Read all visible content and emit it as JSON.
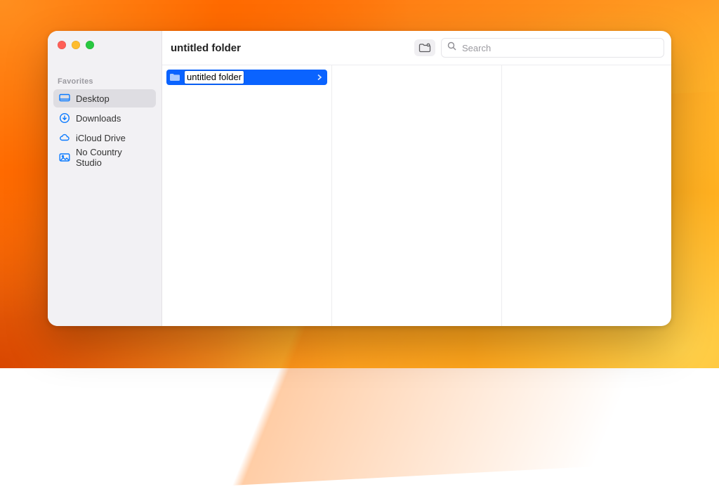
{
  "window": {
    "title": "untitled folder"
  },
  "sidebar": {
    "section_label": "Favorites",
    "items": [
      {
        "label": "Desktop",
        "icon": "desktop",
        "selected": true
      },
      {
        "label": "Downloads",
        "icon": "downloads",
        "selected": false
      },
      {
        "label": "iCloud Drive",
        "icon": "cloud",
        "selected": false
      },
      {
        "label": "No Country Studio",
        "icon": "photos",
        "selected": false
      }
    ]
  },
  "toolbar": {
    "new_folder_button": "New Folder",
    "search_placeholder": "Search"
  },
  "column1": {
    "items": [
      {
        "label": "untitled folder",
        "selected": true,
        "editing": true
      }
    ]
  },
  "colors": {
    "accent": "#0a63ff",
    "sidebar_icon": "#0a7aff"
  }
}
